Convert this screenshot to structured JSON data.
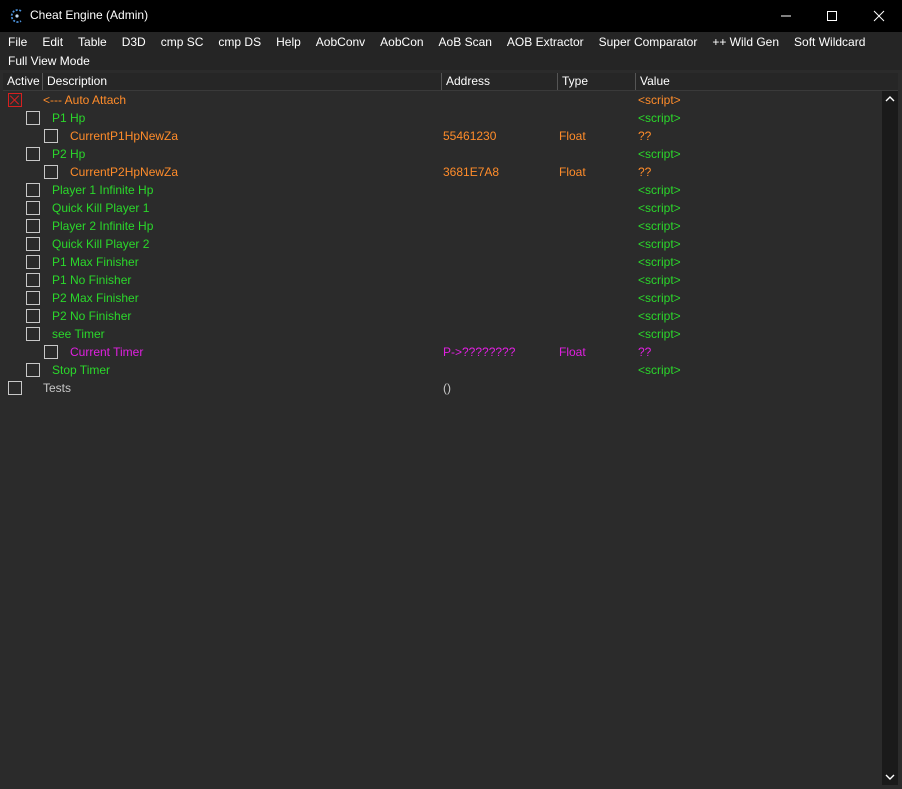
{
  "window": {
    "title": "Cheat Engine (Admin)",
    "controls": [
      "minimize-icon",
      "maximize-icon",
      "close-icon"
    ]
  },
  "menu": {
    "row1": [
      "File",
      "Edit",
      "Table",
      "D3D",
      "cmp SC",
      "cmp DS",
      "Help",
      "AobConv",
      "AobCon",
      "AoB Scan",
      "AOB Extractor",
      "Super Comparator",
      "++ Wild Gen",
      "Soft Wildcard"
    ],
    "row2": [
      "Full View Mode"
    ]
  },
  "columns": {
    "active": "Active",
    "description": "Description",
    "address": "Address",
    "type": "Type",
    "value": "Value"
  },
  "colors": {
    "orange": "#ff8c2a",
    "green": "#2bd82b",
    "magenta": "#e020e0",
    "white": "#ffffff",
    "checkbox_checked": "#d62020"
  },
  "entries": [
    {
      "description": "<--- Auto Attach",
      "address": "",
      "type": "",
      "value": "<script>",
      "color": "#ff8c2a",
      "value_color": "#ff8c2a",
      "checked": true,
      "level": 0
    },
    {
      "description": "P1 Hp",
      "address": "",
      "type": "",
      "value": "<script>",
      "color": "#2bd82b",
      "value_color": "#2bd82b",
      "checked": false,
      "level": 1
    },
    {
      "description": "CurrentP1HpNewZa",
      "address": "55461230",
      "type": "Float",
      "value": "??",
      "color": "#ff8c2a",
      "value_color": "#ff8c2a",
      "checked": false,
      "level": 2
    },
    {
      "description": "P2 Hp",
      "address": "",
      "type": "",
      "value": "<script>",
      "color": "#2bd82b",
      "value_color": "#2bd82b",
      "checked": false,
      "level": 1
    },
    {
      "description": "CurrentP2HpNewZa",
      "address": "3681E7A8",
      "type": "Float",
      "value": "??",
      "color": "#ff8c2a",
      "value_color": "#ff8c2a",
      "checked": false,
      "level": 2
    },
    {
      "description": "Player 1 Infinite Hp",
      "address": "",
      "type": "",
      "value": "<script>",
      "color": "#2bd82b",
      "value_color": "#2bd82b",
      "checked": false,
      "level": 1
    },
    {
      "description": "Quick Kill Player 1",
      "address": "",
      "type": "",
      "value": "<script>",
      "color": "#2bd82b",
      "value_color": "#2bd82b",
      "checked": false,
      "level": 1
    },
    {
      "description": "Player 2 Infinite Hp",
      "address": "",
      "type": "",
      "value": "<script>",
      "color": "#2bd82b",
      "value_color": "#2bd82b",
      "checked": false,
      "level": 1
    },
    {
      "description": "Quick Kill Player 2",
      "address": "",
      "type": "",
      "value": "<script>",
      "color": "#2bd82b",
      "value_color": "#2bd82b",
      "checked": false,
      "level": 1
    },
    {
      "description": "P1 Max Finisher",
      "address": "",
      "type": "",
      "value": "<script>",
      "color": "#2bd82b",
      "value_color": "#2bd82b",
      "checked": false,
      "level": 1
    },
    {
      "description": "P1 No Finisher",
      "address": "",
      "type": "",
      "value": "<script>",
      "color": "#2bd82b",
      "value_color": "#2bd82b",
      "checked": false,
      "level": 1
    },
    {
      "description": "P2 Max Finisher",
      "address": "",
      "type": "",
      "value": "<script>",
      "color": "#2bd82b",
      "value_color": "#2bd82b",
      "checked": false,
      "level": 1
    },
    {
      "description": "P2 No Finisher",
      "address": "",
      "type": "",
      "value": "<script>",
      "color": "#2bd82b",
      "value_color": "#2bd82b",
      "checked": false,
      "level": 1
    },
    {
      "description": "see Timer",
      "address": "",
      "type": "",
      "value": "<script>",
      "color": "#2bd82b",
      "value_color": "#2bd82b",
      "checked": false,
      "level": 1
    },
    {
      "description": "Current Timer",
      "address": "P->????????",
      "type": "Float",
      "value": "??",
      "color": "#e020e0",
      "value_color": "#e020e0",
      "checked": false,
      "level": 2
    },
    {
      "description": "Stop Timer",
      "address": "",
      "type": "",
      "value": "<script>",
      "color": "#2bd82b",
      "value_color": "#2bd82b",
      "checked": false,
      "level": 1
    },
    {
      "description": "Tests",
      "address": "()",
      "type": "",
      "value": "",
      "color": "#c8c8c8",
      "value_color": "#c8c8c8",
      "checked": false,
      "level": 0
    }
  ]
}
